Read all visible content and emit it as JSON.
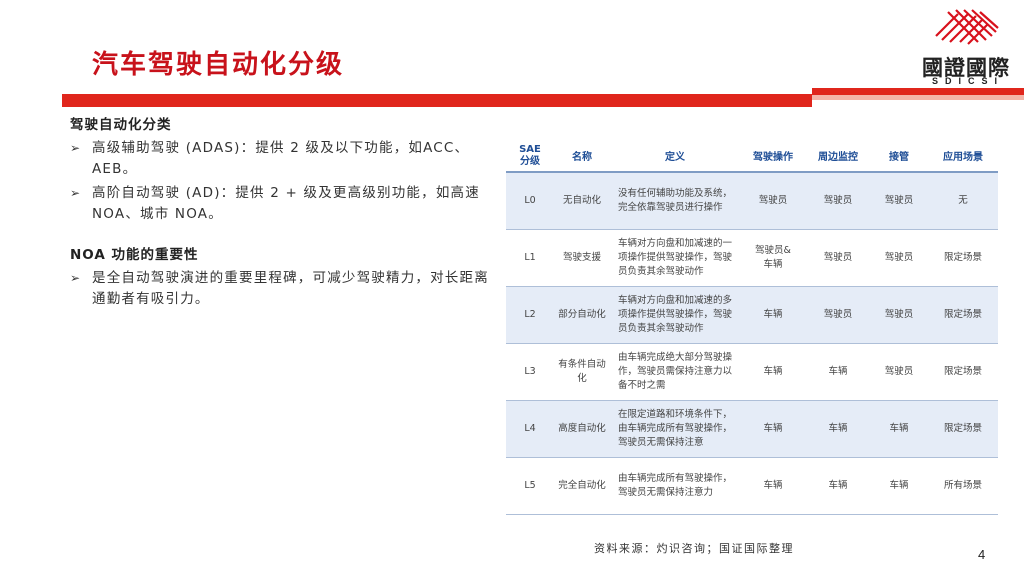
{
  "slide": {
    "title": "汽车驾驶自动化分级",
    "page_number": "4",
    "source": "资料来源：灼识咨询；国证国际整理"
  },
  "logo": {
    "text_cn": "國證國際",
    "text_en": "SDICSI"
  },
  "left": {
    "section1_heading": "驾驶自动化分类",
    "bullets1": [
      "高级辅助驾驶 (ADAS)：提供 2 级及以下功能，如ACC、AEB。",
      "高阶自动驾驶 (AD)：提供 2 + 级及更高级别功能，如高速 NOA、城市 NOA。"
    ],
    "section2_heading": "NOA 功能的重要性",
    "bullets2": [
      "是全自动驾驶演进的重要里程碑，可减少驾驶精力，对长距离通勤者有吸引力。"
    ]
  },
  "table": {
    "headers": [
      "SAE\n分级",
      "名称",
      "定义",
      "驾驶操作",
      "周边监控",
      "接管",
      "应用场景"
    ],
    "rows": [
      [
        "L0",
        "无自动化",
        "没有任何辅助功能及系统，完全依靠驾驶员进行操作",
        "驾驶员",
        "驾驶员",
        "驾驶员",
        "无"
      ],
      [
        "L1",
        "驾驶支援",
        "车辆对方向盘和加减速的一项操作提供驾驶操作，驾驶员负责其余驾驶动作",
        "驾驶员&\n车辆",
        "驾驶员",
        "驾驶员",
        "限定场景"
      ],
      [
        "L2",
        "部分自动化",
        "车辆对方向盘和加减速的多项操作提供驾驶操作，驾驶员负责其余驾驶动作",
        "车辆",
        "驾驶员",
        "驾驶员",
        "限定场景"
      ],
      [
        "L3",
        "有条件自动化",
        "由车辆完成绝大部分驾驶操作，驾驶员需保持注意力以备不时之需",
        "车辆",
        "车辆",
        "驾驶员",
        "限定场景"
      ],
      [
        "L4",
        "高度自动化",
        "在限定道路和环境条件下，由车辆完成所有驾驶操作，驾驶员无需保持注意",
        "车辆",
        "车辆",
        "车辆",
        "限定场景"
      ],
      [
        "L5",
        "完全自动化",
        "由车辆完成所有驾驶操作，驾驶员无需保持注意力",
        "车辆",
        "车辆",
        "车辆",
        "所有场景"
      ]
    ]
  },
  "colors": {
    "title_red": "#c8121b",
    "rule_red": "#e0261c",
    "header_blue": "#1f4e96",
    "row_shade": "#e5ecf7"
  }
}
